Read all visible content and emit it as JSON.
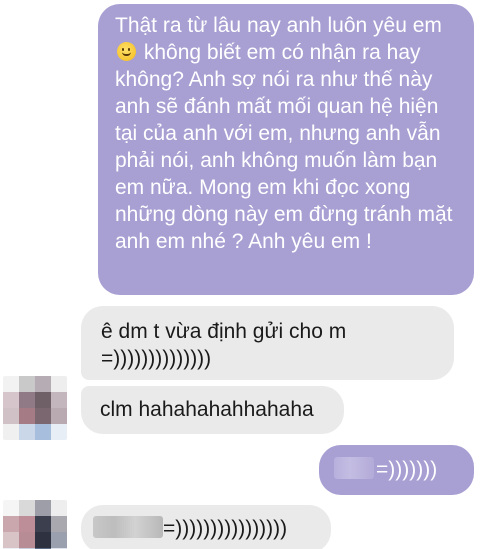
{
  "messages": [
    {
      "direction": "outgoing",
      "text_part1": "Thật ra từ lâu nay anh luôn yêu em",
      "emoji": "smiling-face",
      "text_part2": "không biết em có nhận ra hay không? Anh sợ nói ra như thế này anh sẽ đánh mất mối quan hệ hiện tại của anh với em, nhưng anh vẫn phải nói, anh không muốn làm bạn em nữa. Mong em khi đọc xong những dòng này em đừng tránh mặt anh em nhé ? Anh yêu em !"
    },
    {
      "direction": "incoming",
      "text": "ê dm t vừa định gửi cho m =))))))))))))))"
    },
    {
      "direction": "incoming",
      "text": "clm hahahahahhahaha"
    },
    {
      "direction": "outgoing",
      "text": "=)))))))"
    },
    {
      "direction": "incoming",
      "text": "=))))))))))))))))"
    }
  ],
  "colors": {
    "outgoing_bubble": "#a89fd3",
    "incoming_bubble": "#eaeaea",
    "outgoing_text": "#ffffff",
    "incoming_text": "#1a1a1a"
  },
  "avatars": [
    {
      "name": "contact-avatar-pixelated",
      "pixels": [
        "#f2f2f2",
        "#c9c9c9",
        "#b6adb4",
        "#eeeeee",
        "#d6c6cc",
        "#8f7a85",
        "#6f6068",
        "#c4b6bd",
        "#cfc1c5",
        "#a57b86",
        "#7a6770",
        "#b8aab0",
        "#f0f0f0",
        "#c9d7e8",
        "#a7bfdc",
        "#e8eef5"
      ]
    },
    {
      "name": "contact-avatar-pixelated",
      "pixels": [
        "#f5f5f5",
        "#d9d9d9",
        "#9e9ea8",
        "#eeeeee",
        "#c9a7ad",
        "#bd8e97",
        "#3b3f4e",
        "#a8a8ae",
        "#d8c3c6",
        "#b88c95",
        "#2d3140",
        "#9aa0ad",
        "#eceff3",
        "#c7cfdc",
        "#5c6b86",
        "#dfe4ec"
      ]
    }
  ]
}
